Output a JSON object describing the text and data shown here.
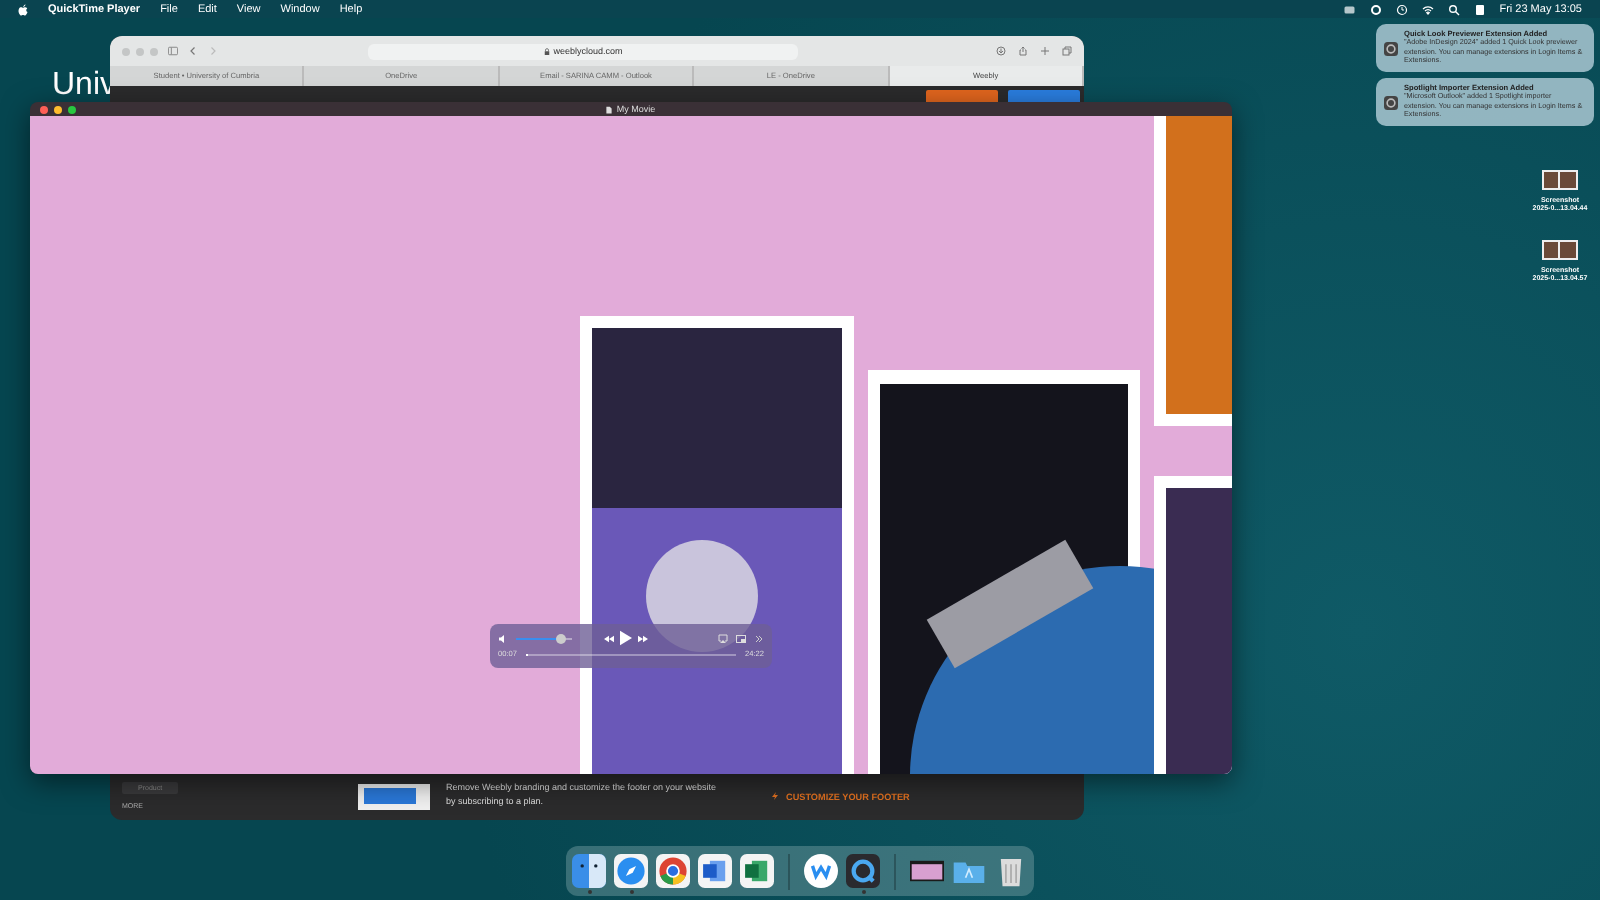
{
  "menu_bar": {
    "app": "QuickTime Player",
    "menus": [
      "File",
      "Edit",
      "View",
      "Window",
      "Help"
    ],
    "clock": "Fri 23 May  13:05"
  },
  "background_window": {
    "heading": "Univ"
  },
  "browser": {
    "address": "weeblycloud.com",
    "tabs": [
      {
        "label": "Student • University of Cumbria",
        "selected": false
      },
      {
        "label": "OneDrive",
        "selected": false
      },
      {
        "label": "Email - SARINA CAMM - Outlook",
        "selected": false
      },
      {
        "label": "LE - OneDrive",
        "selected": false
      },
      {
        "label": "Weebly",
        "selected": true
      }
    ],
    "product_button": "Product",
    "more_label": "MORE",
    "banner_text": "Remove Weebly branding and customize the footer on your website by subscribing to a plan.",
    "banner_action": "CUSTOMIZE YOUR FOOTER"
  },
  "player": {
    "title": "My Movie",
    "volume": {
      "level": 0.8
    },
    "playing": false,
    "elapsed": "00:07",
    "remaining": "24:22",
    "progress": {
      "level": 0.01
    }
  },
  "notifications": [
    {
      "title": "Quick Look Previewer Extension Added",
      "body": "\"Adobe InDesign 2024\" added 1 Quick Look previewer extension. You can manage extensions in Login Items & Extensions."
    },
    {
      "title": "Spotlight Importer Extension Added",
      "body": "\"Microsoft Outlook\" added 1 Spotlight importer extension. You can manage extensions in Login Items & Extensions."
    }
  ],
  "desktop_files": [
    {
      "name": "Screenshot",
      "date": "2025-0...13.04.44"
    },
    {
      "name": "Screenshot",
      "date": "2025-0...13.04.57"
    }
  ],
  "dock": {
    "groups": [
      {
        "apps": [
          {
            "kind": "finder",
            "running": true
          },
          {
            "kind": "safari",
            "running": true
          },
          {
            "kind": "chrome",
            "running": false
          },
          {
            "kind": "word",
            "running": false
          },
          {
            "kind": "excel",
            "running": false
          }
        ]
      },
      {
        "apps": [
          {
            "kind": "weebly",
            "running": false
          },
          {
            "kind": "quicktime",
            "running": true
          }
        ]
      },
      {
        "apps": [
          {
            "kind": "thumbnail",
            "running": false
          },
          {
            "kind": "folder",
            "running": false
          },
          {
            "kind": "trash",
            "running": false
          }
        ]
      }
    ]
  }
}
